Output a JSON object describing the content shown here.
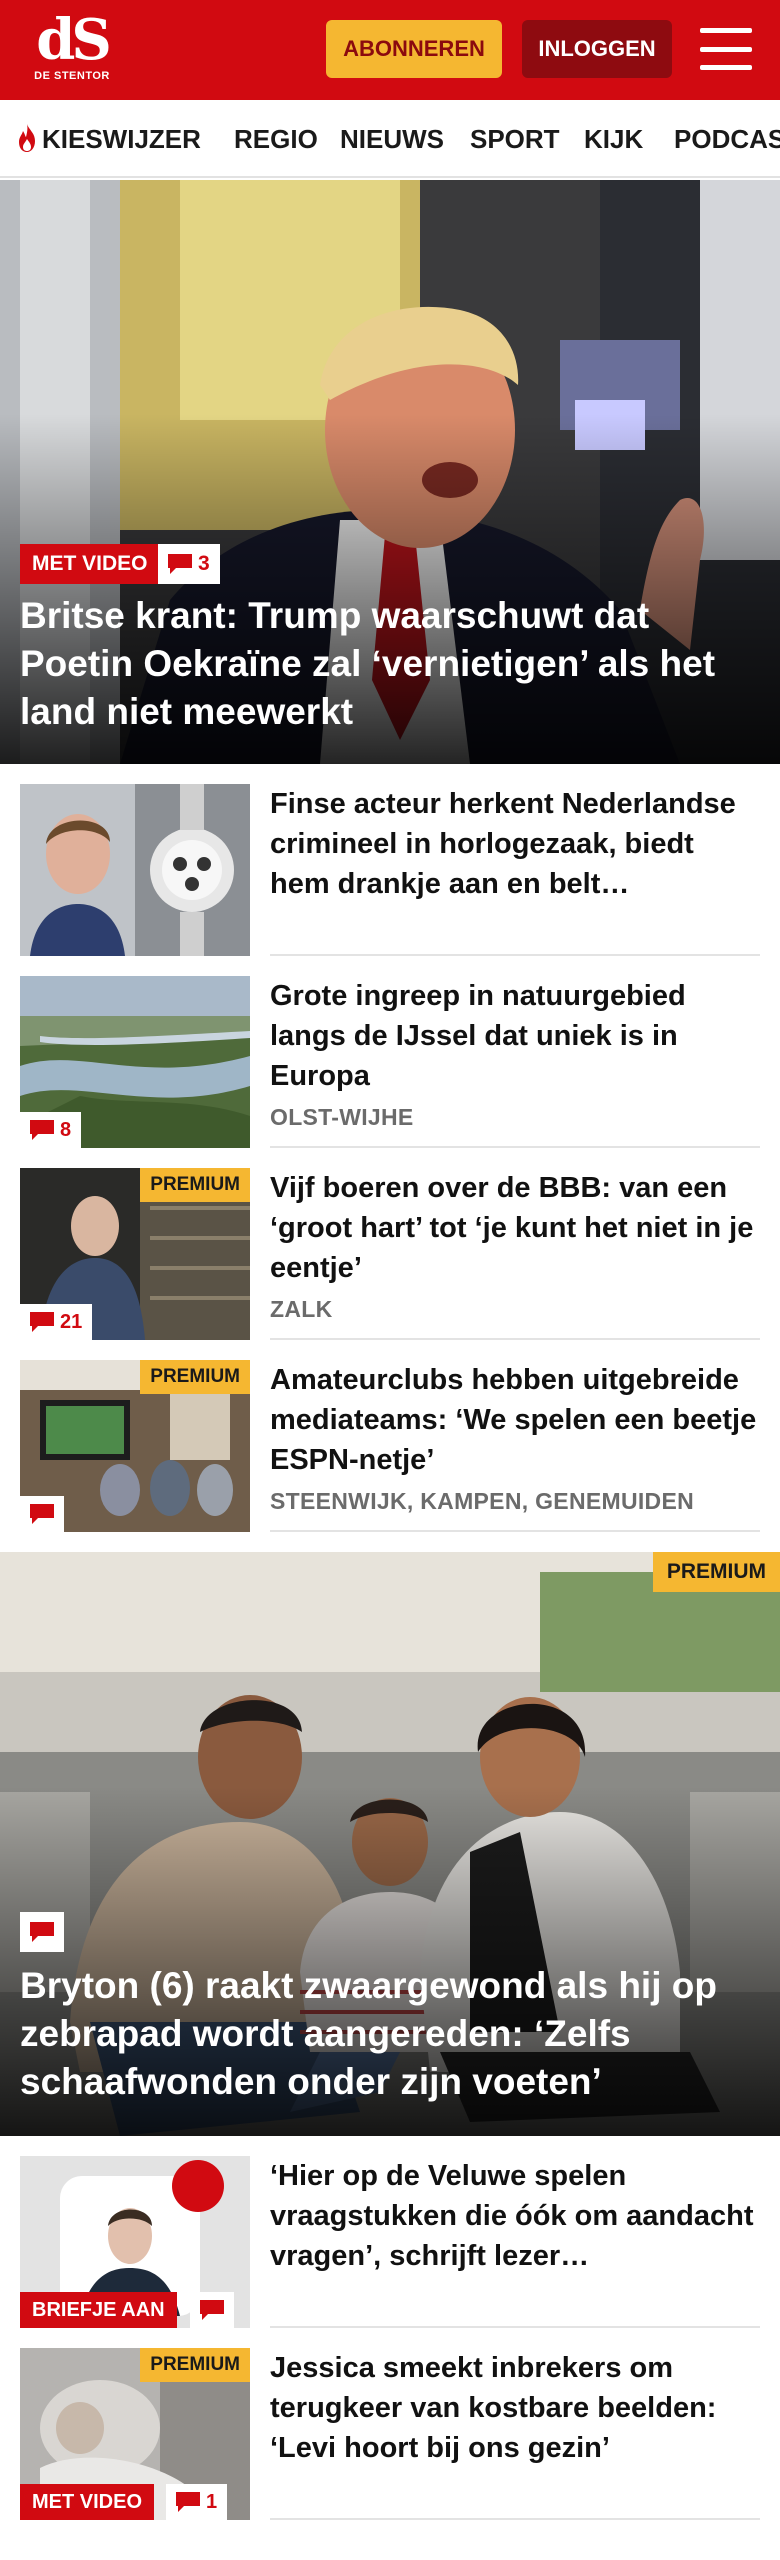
{
  "header": {
    "logo_mark": "dS",
    "logo_sub": "DE STENTOR",
    "subscribe_label": "ABONNEREN",
    "login_label": "INLOGGEN",
    "menu_icon": "hamburger-icon",
    "brand_color": "#d10a11",
    "accent_color": "#f5b731"
  },
  "nav": {
    "items": [
      "KIESWIJZER",
      "REGIO",
      "NIEUWS",
      "SPORT",
      "KIJK",
      "PODCAST"
    ],
    "first_icon": "flame-icon"
  },
  "hero1": {
    "tag": "MET VIDEO",
    "comments": "3",
    "title": "Britse krant: Trump waarschuwt dat Poetin Oekraïne zal ‘vernietigen’ als het land niet meewerkt"
  },
  "articles": [
    {
      "title": "Finse acteur herkent Nederland­se crimineel in horlogezaak, biedt hem drankje aan en belt…",
      "location": "",
      "comments": "",
      "premium": ""
    },
    {
      "title": "Grote ingreep in natuurgebied langs de IJssel dat uniek is in Europa",
      "location": "OLST-WIJHE",
      "comments": "8",
      "premium": ""
    },
    {
      "title": "Vijf boeren over de BBB: van een ‘groot hart’ tot ‘je kunt het niet in je eentje’",
      "location": "ZALK",
      "comments": "21",
      "premium": "PREMIUM"
    },
    {
      "title": "Amateurclubs hebben uitgebrei­de mediateams: ‘We spelen een beetje ESPN-netje’",
      "location": "STEENWIJK, KAMPEN, GENEMUIDEN",
      "comments": "",
      "premium": "PREMIUM"
    }
  ],
  "hero2": {
    "premium": "PREMIUM",
    "title": "Bryton (6) raakt zwaargewond als hij op zebrapad wordt aangereden: ‘Zelfs schaafwonden onder zijn voeten’"
  },
  "articles2": [
    {
      "title": "‘Hier op de Veluwe spelen vraagstukken die óók om aandacht vragen’, schrijft lezer…",
      "tag": "BRIEFJE AAN",
      "comments": "",
      "premium": ""
    },
    {
      "title": "Jessica smeekt inbrekers om terugkeer van kostbare beelden: ‘Levi hoort bij ons gezin’",
      "tag": "MET VIDEO",
      "comments": "1",
      "premium": "PREMIUM"
    }
  ]
}
